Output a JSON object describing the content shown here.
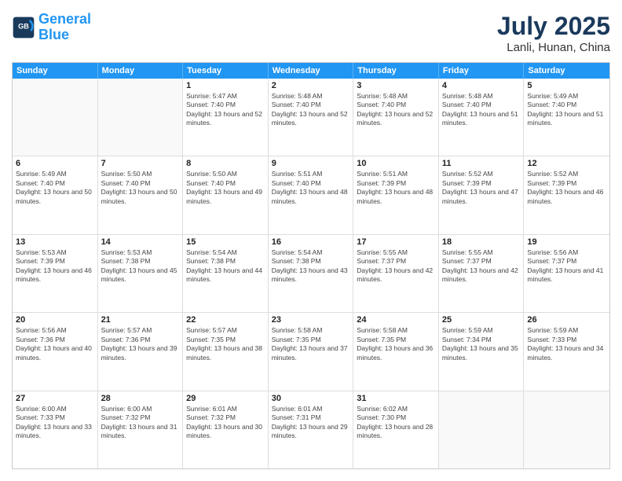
{
  "header": {
    "logo_line1": "General",
    "logo_line2": "Blue",
    "month": "July 2025",
    "location": "Lanli, Hunan, China"
  },
  "weekdays": [
    "Sunday",
    "Monday",
    "Tuesday",
    "Wednesday",
    "Thursday",
    "Friday",
    "Saturday"
  ],
  "rows": [
    [
      {
        "day": "",
        "text": ""
      },
      {
        "day": "",
        "text": ""
      },
      {
        "day": "1",
        "text": "Sunrise: 5:47 AM\nSunset: 7:40 PM\nDaylight: 13 hours and 52 minutes."
      },
      {
        "day": "2",
        "text": "Sunrise: 5:48 AM\nSunset: 7:40 PM\nDaylight: 13 hours and 52 minutes."
      },
      {
        "day": "3",
        "text": "Sunrise: 5:48 AM\nSunset: 7:40 PM\nDaylight: 13 hours and 52 minutes."
      },
      {
        "day": "4",
        "text": "Sunrise: 5:48 AM\nSunset: 7:40 PM\nDaylight: 13 hours and 51 minutes."
      },
      {
        "day": "5",
        "text": "Sunrise: 5:49 AM\nSunset: 7:40 PM\nDaylight: 13 hours and 51 minutes."
      }
    ],
    [
      {
        "day": "6",
        "text": "Sunrise: 5:49 AM\nSunset: 7:40 PM\nDaylight: 13 hours and 50 minutes."
      },
      {
        "day": "7",
        "text": "Sunrise: 5:50 AM\nSunset: 7:40 PM\nDaylight: 13 hours and 50 minutes."
      },
      {
        "day": "8",
        "text": "Sunrise: 5:50 AM\nSunset: 7:40 PM\nDaylight: 13 hours and 49 minutes."
      },
      {
        "day": "9",
        "text": "Sunrise: 5:51 AM\nSunset: 7:40 PM\nDaylight: 13 hours and 48 minutes."
      },
      {
        "day": "10",
        "text": "Sunrise: 5:51 AM\nSunset: 7:39 PM\nDaylight: 13 hours and 48 minutes."
      },
      {
        "day": "11",
        "text": "Sunrise: 5:52 AM\nSunset: 7:39 PM\nDaylight: 13 hours and 47 minutes."
      },
      {
        "day": "12",
        "text": "Sunrise: 5:52 AM\nSunset: 7:39 PM\nDaylight: 13 hours and 46 minutes."
      }
    ],
    [
      {
        "day": "13",
        "text": "Sunrise: 5:53 AM\nSunset: 7:39 PM\nDaylight: 13 hours and 46 minutes."
      },
      {
        "day": "14",
        "text": "Sunrise: 5:53 AM\nSunset: 7:38 PM\nDaylight: 13 hours and 45 minutes."
      },
      {
        "day": "15",
        "text": "Sunrise: 5:54 AM\nSunset: 7:38 PM\nDaylight: 13 hours and 44 minutes."
      },
      {
        "day": "16",
        "text": "Sunrise: 5:54 AM\nSunset: 7:38 PM\nDaylight: 13 hours and 43 minutes."
      },
      {
        "day": "17",
        "text": "Sunrise: 5:55 AM\nSunset: 7:37 PM\nDaylight: 13 hours and 42 minutes."
      },
      {
        "day": "18",
        "text": "Sunrise: 5:55 AM\nSunset: 7:37 PM\nDaylight: 13 hours and 42 minutes."
      },
      {
        "day": "19",
        "text": "Sunrise: 5:56 AM\nSunset: 7:37 PM\nDaylight: 13 hours and 41 minutes."
      }
    ],
    [
      {
        "day": "20",
        "text": "Sunrise: 5:56 AM\nSunset: 7:36 PM\nDaylight: 13 hours and 40 minutes."
      },
      {
        "day": "21",
        "text": "Sunrise: 5:57 AM\nSunset: 7:36 PM\nDaylight: 13 hours and 39 minutes."
      },
      {
        "day": "22",
        "text": "Sunrise: 5:57 AM\nSunset: 7:35 PM\nDaylight: 13 hours and 38 minutes."
      },
      {
        "day": "23",
        "text": "Sunrise: 5:58 AM\nSunset: 7:35 PM\nDaylight: 13 hours and 37 minutes."
      },
      {
        "day": "24",
        "text": "Sunrise: 5:58 AM\nSunset: 7:35 PM\nDaylight: 13 hours and 36 minutes."
      },
      {
        "day": "25",
        "text": "Sunrise: 5:59 AM\nSunset: 7:34 PM\nDaylight: 13 hours and 35 minutes."
      },
      {
        "day": "26",
        "text": "Sunrise: 5:59 AM\nSunset: 7:33 PM\nDaylight: 13 hours and 34 minutes."
      }
    ],
    [
      {
        "day": "27",
        "text": "Sunrise: 6:00 AM\nSunset: 7:33 PM\nDaylight: 13 hours and 33 minutes."
      },
      {
        "day": "28",
        "text": "Sunrise: 6:00 AM\nSunset: 7:32 PM\nDaylight: 13 hours and 31 minutes."
      },
      {
        "day": "29",
        "text": "Sunrise: 6:01 AM\nSunset: 7:32 PM\nDaylight: 13 hours and 30 minutes."
      },
      {
        "day": "30",
        "text": "Sunrise: 6:01 AM\nSunset: 7:31 PM\nDaylight: 13 hours and 29 minutes."
      },
      {
        "day": "31",
        "text": "Sunrise: 6:02 AM\nSunset: 7:30 PM\nDaylight: 13 hours and 28 minutes."
      },
      {
        "day": "",
        "text": ""
      },
      {
        "day": "",
        "text": ""
      }
    ]
  ]
}
